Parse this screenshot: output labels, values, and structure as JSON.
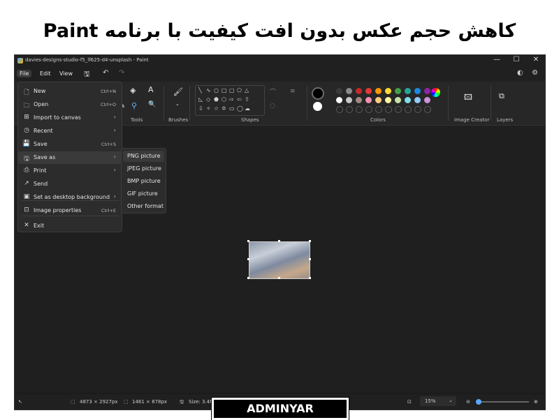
{
  "banner": {
    "text": "کاهش حجم عکس بدون افت کیفیت با برنامه Paint"
  },
  "window": {
    "title": "davies-designs-studio-f5_lf625-d4-unsplash - Paint",
    "minimize": "—",
    "maximize": "☐",
    "close": "✕"
  },
  "menubar": {
    "file": "File",
    "edit": "Edit",
    "view": "View"
  },
  "ribbon": {
    "tools_label": "Tools",
    "brushes_label": "Brushes",
    "shapes_label": "Shapes",
    "colors_label": "Colors",
    "image_creator_label": "Image Creator",
    "layers_label": "Layers"
  },
  "colors": {
    "row1": [
      "#3b3b3b",
      "#8a8a8a",
      "#c62828",
      "#e53935",
      "#ff9800",
      "#fdd835",
      "#43a047",
      "#26a69a",
      "#1e88e5",
      "#8e24aa"
    ],
    "row2": [
      "#ffffff",
      "#c8c8c8",
      "#a1887f",
      "#f48fb1",
      "#ffcc80",
      "#fff59d",
      "#c5e1a5",
      "#80deea",
      "#90caf9",
      "#ce93d8"
    ],
    "primary": "#000000",
    "secondary": "#ffffff"
  },
  "file_menu": {
    "items": [
      {
        "icon": "new-file-icon",
        "glyph": "🗋",
        "label": "New",
        "shortcut": "Ctrl+N"
      },
      {
        "icon": "open-folder-icon",
        "glyph": "🗀",
        "label": "Open",
        "shortcut": "Ctrl+O"
      },
      {
        "icon": "import-icon",
        "glyph": "⊞",
        "label": "Import to canvas",
        "shortcut": "›"
      },
      {
        "icon": "recent-clock-icon",
        "glyph": "◷",
        "label": "Recent",
        "shortcut": "›"
      },
      {
        "icon": "save-disk-icon",
        "glyph": "💾",
        "label": "Save",
        "shortcut": "Ctrl+S"
      },
      {
        "icon": "save-as-icon",
        "glyph": "🖫",
        "label": "Save as",
        "shortcut": "›"
      },
      {
        "icon": "print-icon",
        "glyph": "⎙",
        "label": "Print",
        "shortcut": "›"
      },
      {
        "icon": "send-icon",
        "glyph": "↗",
        "label": "Send",
        "shortcut": ""
      },
      {
        "icon": "desktop-background-icon",
        "glyph": "▣",
        "label": "Set as desktop background",
        "shortcut": "›"
      },
      {
        "icon": "image-properties-icon",
        "glyph": "⊡",
        "label": "Image properties",
        "shortcut": "Ctrl+E"
      },
      {
        "icon": "exit-icon",
        "glyph": "✕",
        "label": "Exit",
        "shortcut": ""
      }
    ]
  },
  "save_as_menu": [
    "PNG picture",
    "JPEG picture",
    "BMP picture",
    "GIF picture",
    "Other format"
  ],
  "status": {
    "canvas_size": "4873 × 2927px",
    "selection_size": "1461 × 878px",
    "file_size": "Size: 3.4M",
    "zoom": "15%"
  },
  "watermark": {
    "text": "ADMINYAR"
  }
}
